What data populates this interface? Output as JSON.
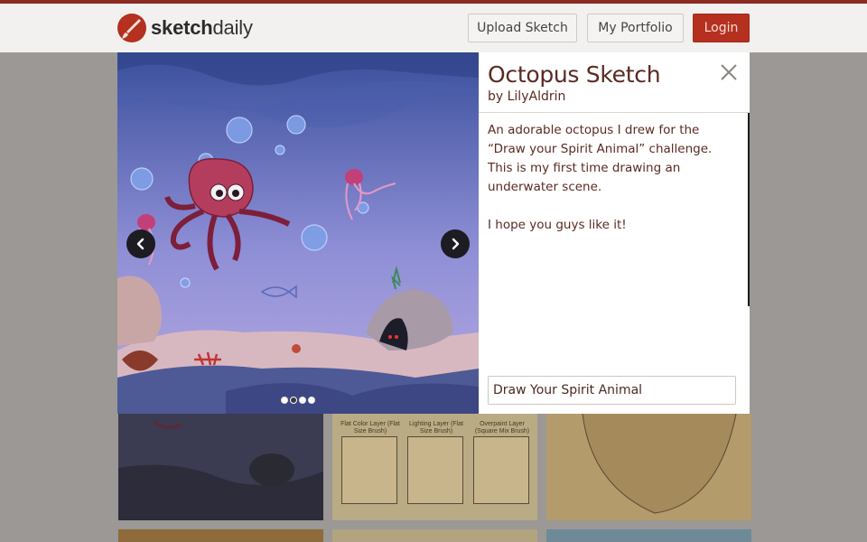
{
  "header": {
    "logo_bold": "sketch",
    "logo_light": "daily",
    "upload_label": "Upload Sketch",
    "portfolio_label": "My Portfolio",
    "login_label": "Login"
  },
  "gallery": {
    "thumb2_layers": [
      "Flat Color Layer (Flat Size Brush)",
      "Lighting Layer (Flat Size Brush)",
      "Overpaint Layer (Square Mix Brush)"
    ]
  },
  "modal": {
    "title": "Octopus Sketch",
    "author": "by LilyAldrin",
    "description": [
      "An adorable octopus I drew for the “Draw your Spirit Animal” challenge. This is my first time drawing an underwater scene.",
      "I hope you guys like it!"
    ],
    "tag": "Draw Your Spirit Animal",
    "carousel": {
      "slide_count": 4,
      "active_index": 1
    }
  },
  "colors": {
    "brand_red": "#b5301f",
    "title_text": "#5a2a22",
    "topline": "#8a2a22"
  },
  "icons": [
    "brush-logo-icon",
    "chevron-left-icon",
    "chevron-right-icon",
    "close-icon"
  ]
}
